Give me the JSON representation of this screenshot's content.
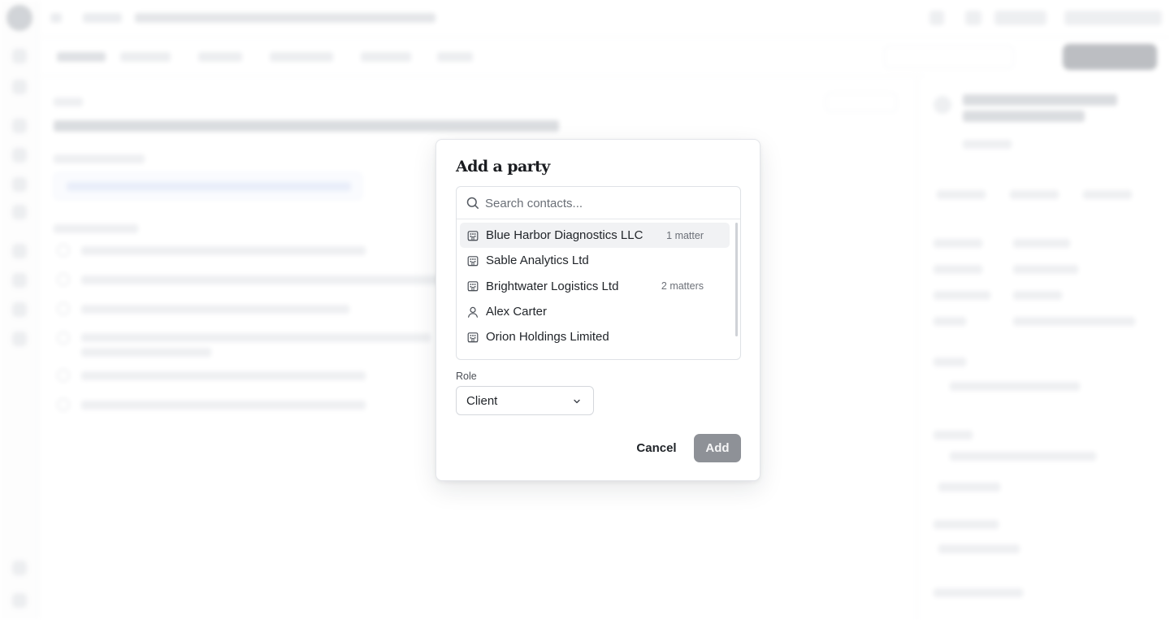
{
  "dialog": {
    "title": "Add a party",
    "search": {
      "placeholder": "Search contacts...",
      "value": ""
    },
    "contacts": [
      {
        "name": "Blue Harbor Diagnostics LLC",
        "kind": "organization",
        "icon": "building-icon",
        "meta": "1 matter",
        "selected": true
      },
      {
        "name": "Sable Analytics Ltd",
        "kind": "organization",
        "icon": "building-icon",
        "meta": "",
        "selected": false
      },
      {
        "name": "Brightwater Logistics Ltd",
        "kind": "organization",
        "icon": "building-icon",
        "meta": "2 matters",
        "selected": false
      },
      {
        "name": "Alex Carter",
        "kind": "person",
        "icon": "person-icon",
        "meta": "",
        "selected": false
      },
      {
        "name": "Orion Holdings Limited",
        "kind": "organization",
        "icon": "building-icon",
        "meta": "",
        "selected": false
      }
    ],
    "role": {
      "label": "Role",
      "value": "Client"
    },
    "actions": {
      "cancel": "Cancel",
      "add": "Add"
    }
  },
  "colors": {
    "add_button_disabled": "#8e9197",
    "selected_row": "#f1f2f4",
    "overlay": "rgba(255,255,255,0.55)"
  }
}
